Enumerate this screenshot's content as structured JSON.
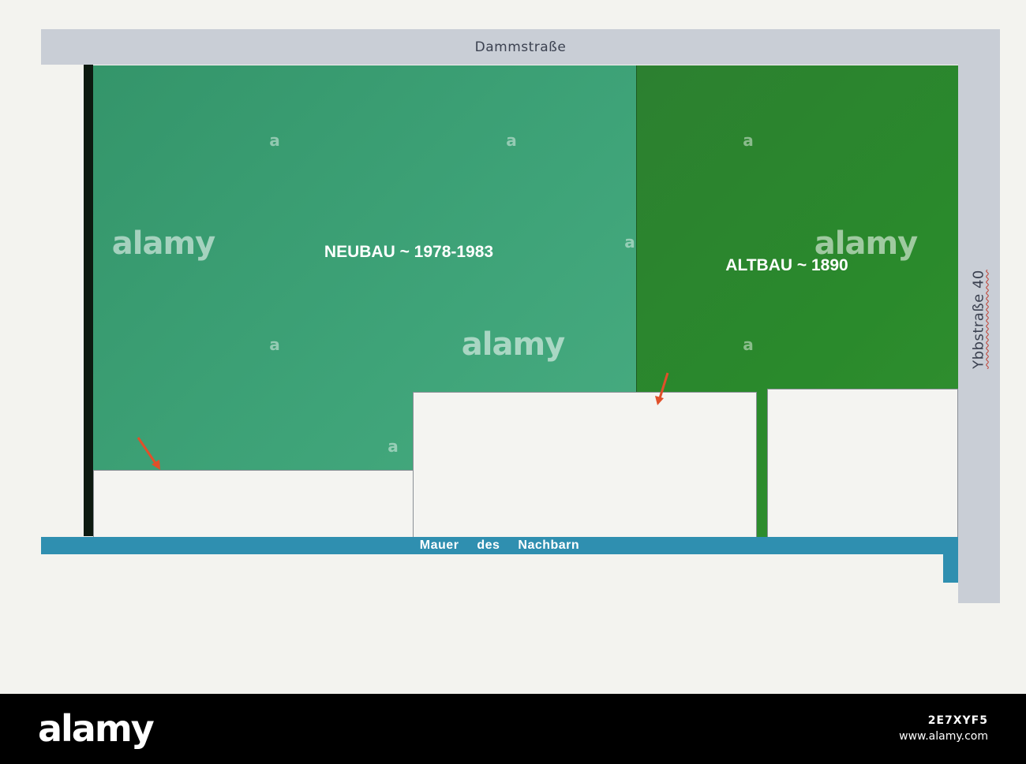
{
  "streets": {
    "top": "Dammstraße",
    "right": "Ybbstraße 40"
  },
  "buildings": {
    "neubau": "NEUBAU ~ 1978-1983",
    "altbau": "ALTBAU ~ 1890"
  },
  "wall": {
    "label": "Mauer des Nachbarn"
  },
  "watermark": {
    "text": "alamy",
    "small": "a"
  },
  "banner": {
    "logo": "alamy",
    "image_id": "2E7XYF5",
    "url": "www.alamy.com"
  },
  "colors": {
    "neubau": "#3ea378",
    "altbau": "#2a8a2c",
    "street": "#c9ced6",
    "wall": "#2f8fb0",
    "arrow": "#e0502a"
  }
}
